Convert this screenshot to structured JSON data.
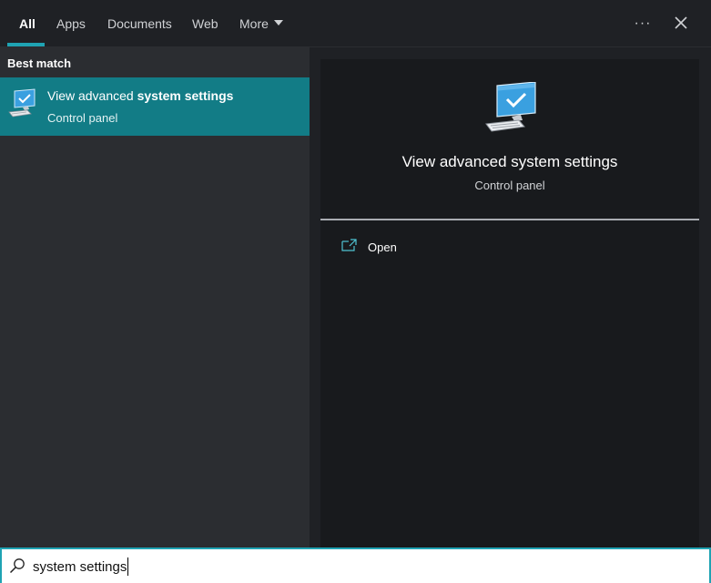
{
  "tabs": [
    {
      "label": "All",
      "active": true
    },
    {
      "label": "Apps",
      "active": false
    },
    {
      "label": "Documents",
      "active": false
    },
    {
      "label": "Web",
      "active": false
    },
    {
      "label": "More",
      "active": false
    }
  ],
  "toolbar": {
    "more_options_icon": "ellipsis-icon",
    "close_icon": "close-icon"
  },
  "results": {
    "section_header": "Best match",
    "items": [
      {
        "title_prefix": "View advanced ",
        "title_highlight": "system settings",
        "subtitle": "Control panel",
        "icon": "computer-monitor-check-icon"
      }
    ]
  },
  "preview": {
    "title": "View advanced system settings",
    "subtitle": "Control panel",
    "icon": "computer-monitor-check-icon",
    "actions": [
      {
        "label": "Open",
        "icon": "open-window-icon"
      }
    ]
  },
  "search": {
    "value": "system settings",
    "icon": "search-icon"
  },
  "colors": {
    "accent": "#1fa3b3",
    "selected_bg": "#127c86",
    "pane_bg": "#2b2d31",
    "preview_bg": "#181a1d"
  }
}
